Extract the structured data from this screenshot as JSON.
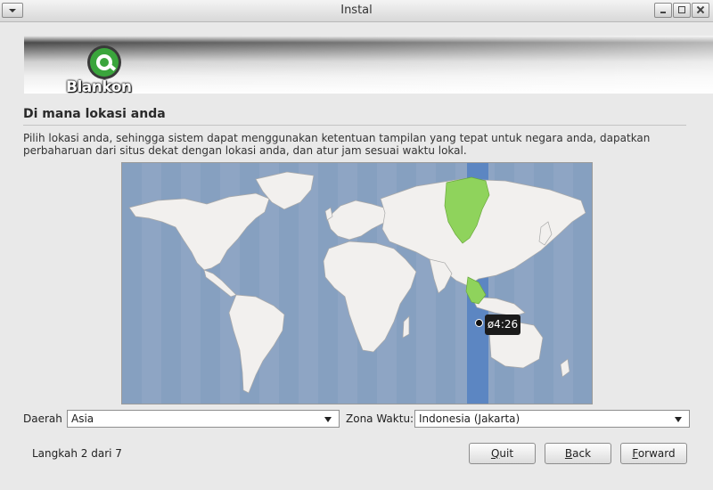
{
  "window": {
    "title": "Instal"
  },
  "branding": {
    "logo_text": "Blankon"
  },
  "page": {
    "heading": "Di mana lokasi anda",
    "description": "Pilih lokasi anda, sehingga sistem dapat menggunakan ketentuan tampilan yang tepat untuk negara anda, dapatkan perbaharuan dari situs dekat dengan lokasi anda, dan atur jam sesuai waktu lokal."
  },
  "map": {
    "selected_time": "ø4:26",
    "colors": {
      "ocean": "#8ea5c4",
      "land": "#f2f0ee",
      "selected_zone_band": "#5c86c2",
      "selected_region": "#8fd35c"
    }
  },
  "location": {
    "region_label": "Daerah",
    "region_value": "Asia",
    "timezone_label": "Zona Waktu:",
    "timezone_value": "Indonesia (Jakarta)"
  },
  "footer": {
    "step_text": "Langkah 2 dari 7",
    "buttons": {
      "quit": {
        "mnemonic": "Q",
        "rest": "uit"
      },
      "back": {
        "mnemonic": "B",
        "rest": "ack"
      },
      "forward": {
        "mnemonic": "F",
        "rest": "orward"
      }
    }
  }
}
